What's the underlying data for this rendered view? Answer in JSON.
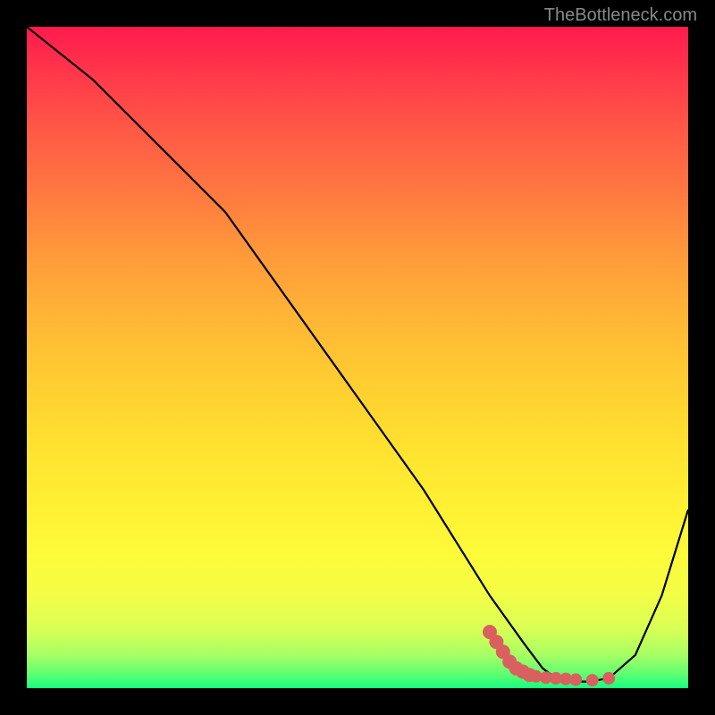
{
  "watermark": "TheBottleneck.com",
  "chart_data": {
    "type": "line",
    "title": "",
    "xlabel": "",
    "ylabel": "",
    "xlim": [
      0,
      100
    ],
    "ylim": [
      0,
      100
    ],
    "series": [
      {
        "name": "curve",
        "x": [
          0,
          10,
          20,
          25,
          30,
          40,
          50,
          60,
          65,
          70,
          75,
          78,
          80,
          82,
          85,
          88,
          92,
          96,
          100
        ],
        "y": [
          100,
          92,
          82,
          77,
          72,
          58,
          44,
          30,
          22,
          14,
          7,
          3,
          1.5,
          1,
          1,
          1.5,
          5,
          14,
          27
        ]
      }
    ],
    "markers": {
      "name": "highlight-points",
      "color": "#d9605e",
      "points": [
        {
          "x": 70,
          "y": 8.5
        },
        {
          "x": 71,
          "y": 7
        },
        {
          "x": 72,
          "y": 5.5
        },
        {
          "x": 73,
          "y": 4
        },
        {
          "x": 74,
          "y": 3
        },
        {
          "x": 75,
          "y": 2.5
        },
        {
          "x": 76,
          "y": 2
        },
        {
          "x": 77,
          "y": 1.8
        },
        {
          "x": 78.5,
          "y": 1.6
        },
        {
          "x": 80,
          "y": 1.5
        },
        {
          "x": 81.5,
          "y": 1.4
        },
        {
          "x": 83,
          "y": 1.3
        },
        {
          "x": 85.5,
          "y": 1.2
        },
        {
          "x": 88,
          "y": 1.5
        }
      ]
    },
    "gradient_stops": [
      {
        "pos": 0,
        "color": "#ff1a4d"
      },
      {
        "pos": 25,
        "color": "#ff7840"
      },
      {
        "pos": 50,
        "color": "#ffc233"
      },
      {
        "pos": 75,
        "color": "#fdfb3a"
      },
      {
        "pos": 100,
        "color": "#15ff7e"
      }
    ]
  }
}
